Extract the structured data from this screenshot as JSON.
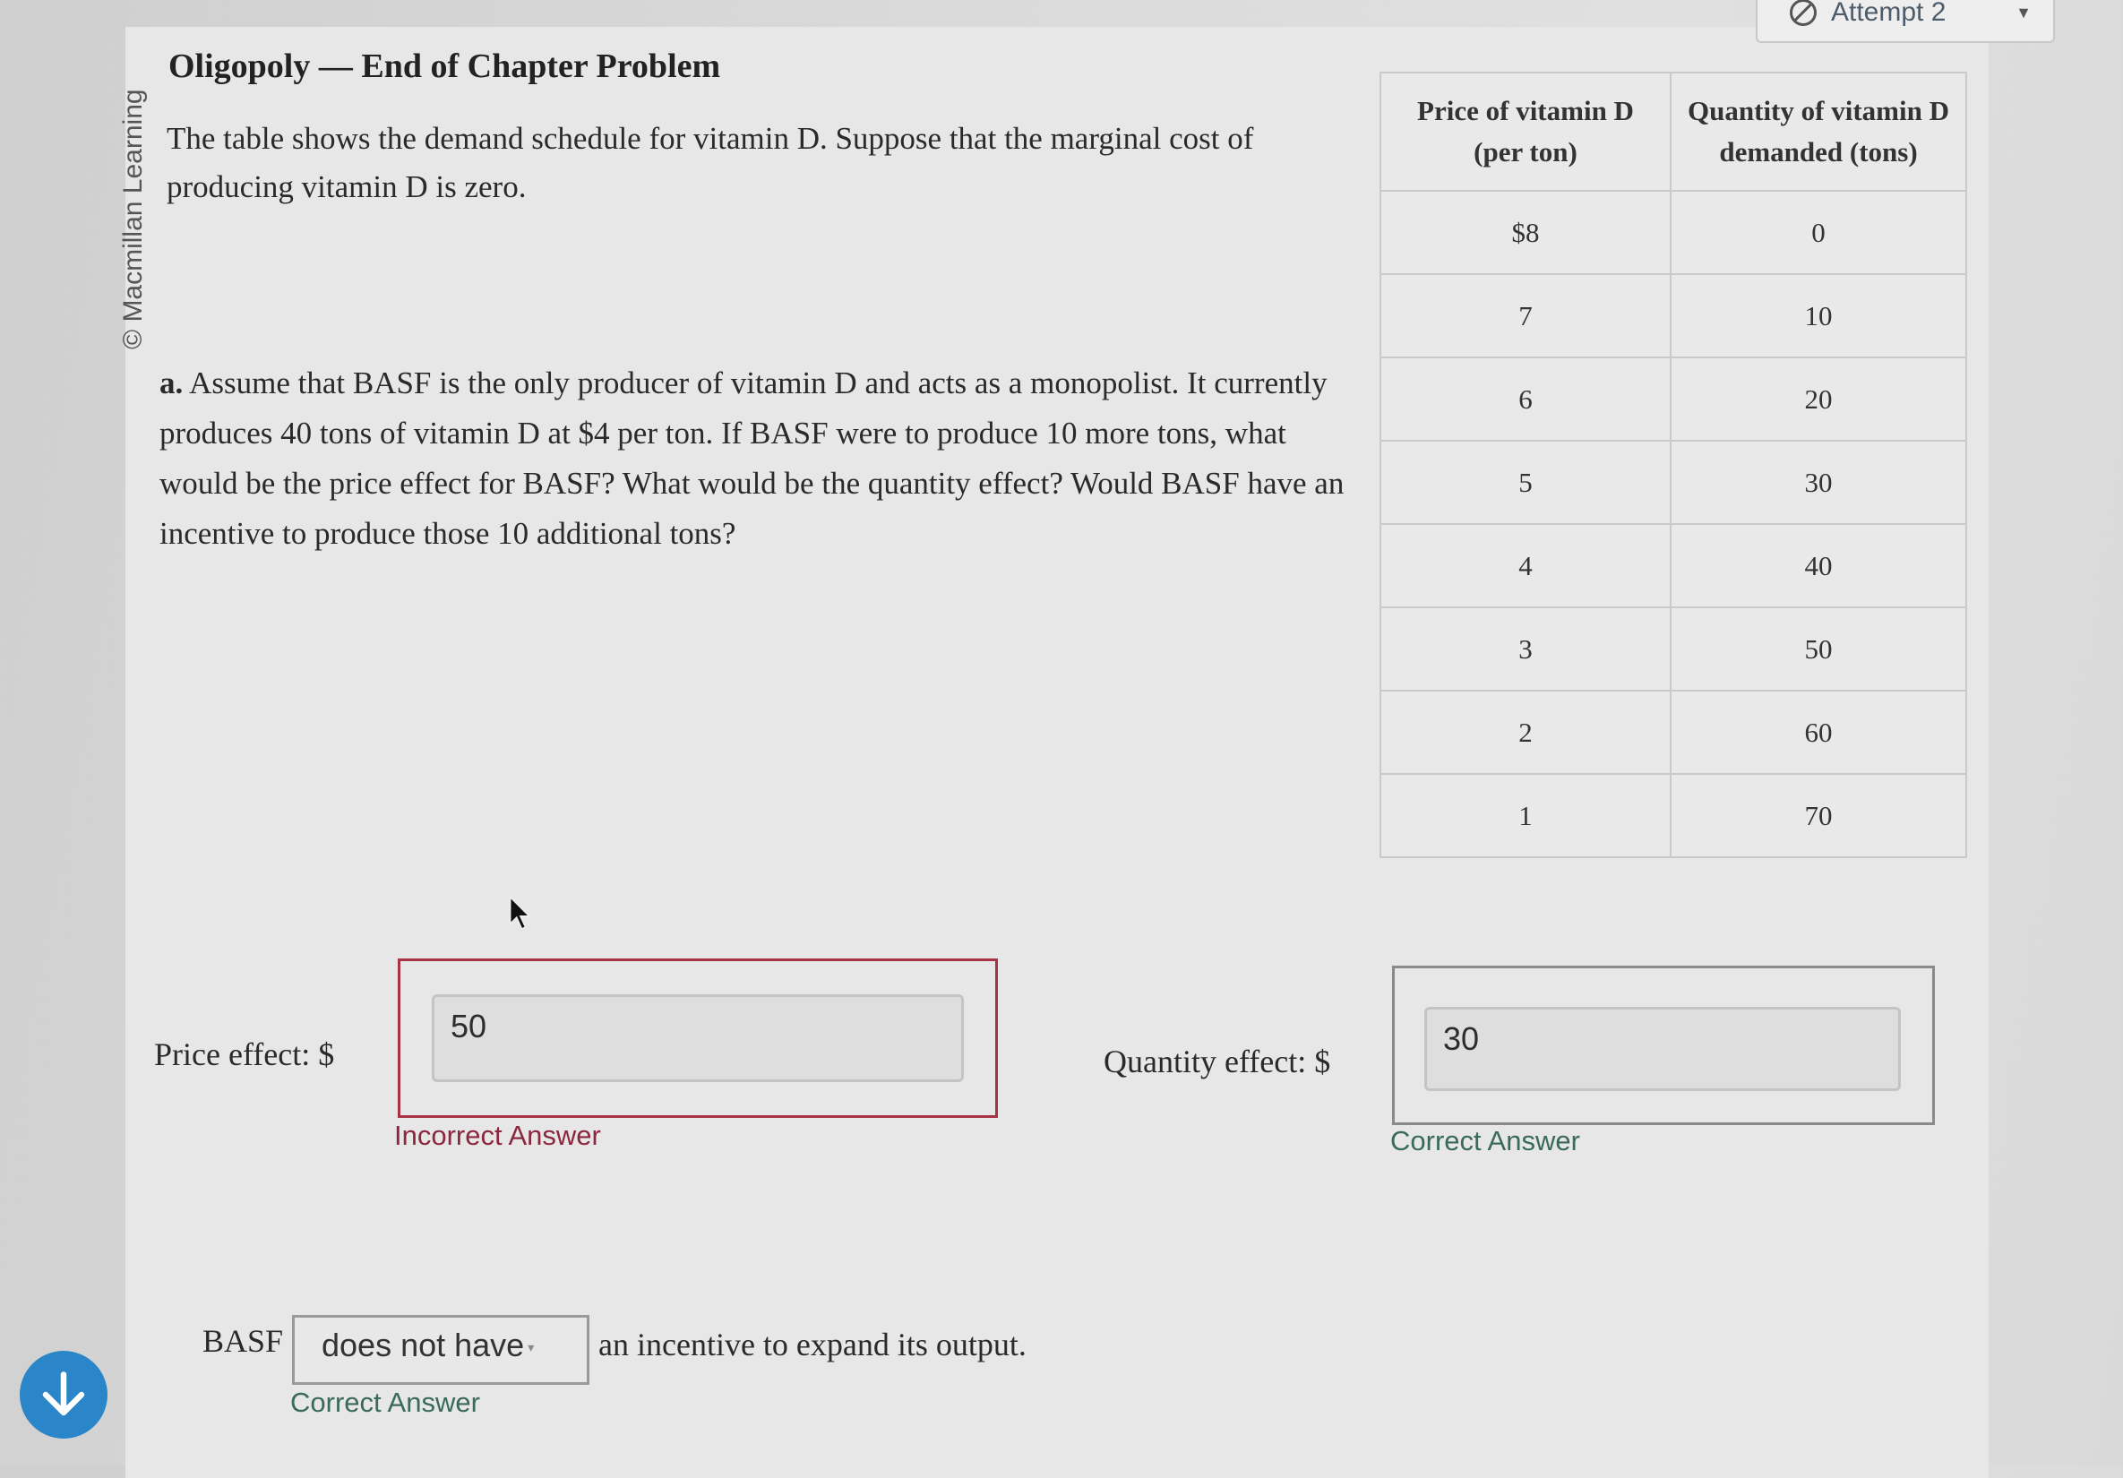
{
  "header": {
    "attempt_label": "Attempt 2"
  },
  "sidebar": {
    "copyright": "© Macmillan Learning"
  },
  "problem": {
    "title": "Oligopoly — End of Chapter Problem",
    "intro": "The table shows the demand schedule for vitamin D. Suppose that the marginal cost of producing vitamin D is zero.",
    "part_label": "a.",
    "question": "Assume that BASF is the only producer of vitamin D and acts as a monopolist. It currently produces 40 tons of vitamin D at $4 per ton. If BASF were to produce 10 more tons, what would be the price effect for BASF? What would be the quantity effect? Would BASF have an incentive to produce those 10 additional tons?"
  },
  "demand_table": {
    "headers": [
      "Price of vitamin D (per ton)",
      "Quantity of vitamin D demanded (tons)"
    ],
    "rows": [
      [
        "$8",
        "0"
      ],
      [
        "7",
        "10"
      ],
      [
        "6",
        "20"
      ],
      [
        "5",
        "30"
      ],
      [
        "4",
        "40"
      ],
      [
        "3",
        "50"
      ],
      [
        "2",
        "60"
      ],
      [
        "1",
        "70"
      ]
    ]
  },
  "answers": {
    "price_effect_label": "Price effect: $",
    "price_effect_value": "50",
    "price_effect_feedback": "Incorrect Answer",
    "quantity_effect_label": "Quantity effect: $",
    "quantity_effect_value": "30",
    "quantity_effect_feedback": "Correct Answer",
    "incentive_prefix": "BASF",
    "incentive_selected": "does not have",
    "incentive_suffix": "an incentive to expand its output.",
    "incentive_feedback": "Correct Answer"
  },
  "colors": {
    "incorrect": "#a83246",
    "correct": "#3a6b5a",
    "accent_button": "#2a86c8"
  }
}
